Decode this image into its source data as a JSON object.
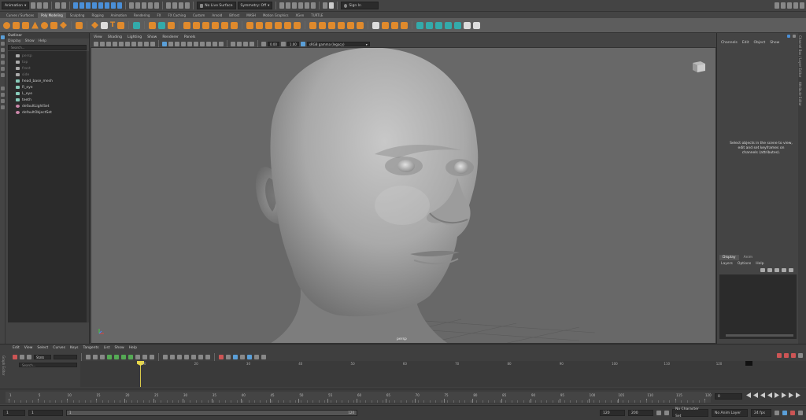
{
  "statusline": {
    "menuset": "Animation",
    "live_surface": "No Live Surface",
    "symmetry": "Symmetry: Off",
    "sign_in": "Sign In"
  },
  "shelf": {
    "tabs": [
      "Curves / Surfaces",
      "Poly Modeling",
      "Sculpting",
      "Rigging",
      "Animation",
      "Rendering",
      "FX",
      "FX Caching",
      "Custom",
      "Arnold",
      "Bifrost",
      "MASH",
      "Motion Graphics",
      "XGen",
      "TURTLE"
    ],
    "active_tab": "Poly Modeling"
  },
  "outliner": {
    "title": "Outliner",
    "menu": [
      "Display",
      "Show",
      "Help"
    ],
    "search_placeholder": "Search...",
    "items": [
      {
        "label": "persp",
        "dim": true,
        "type": "camera"
      },
      {
        "label": "top",
        "dim": true,
        "type": "camera"
      },
      {
        "label": "front",
        "dim": true,
        "type": "camera"
      },
      {
        "label": "side",
        "dim": true,
        "type": "camera"
      },
      {
        "label": "head_base_mesh",
        "dim": false,
        "type": "mesh"
      },
      {
        "label": "R_eye",
        "dim": false,
        "type": "mesh"
      },
      {
        "label": "L_eye",
        "dim": false,
        "type": "mesh"
      },
      {
        "label": "teeth",
        "dim": false,
        "type": "mesh"
      },
      {
        "label": "defaultLightSet",
        "dim": false,
        "type": "set"
      },
      {
        "label": "defaultObjectSet",
        "dim": false,
        "type": "set"
      }
    ]
  },
  "viewport": {
    "menu": [
      "View",
      "Shading",
      "Lighting",
      "Show",
      "Renderer",
      "Panels"
    ],
    "field1": "0.00",
    "field2": "1.00",
    "colorspace": "sRGB gamma (legacy)",
    "camera": "persp"
  },
  "channelbox": {
    "menu": [
      "Channels",
      "Edit",
      "Object",
      "Show"
    ],
    "hint": "Select objects in the scene to view, edit and set keyframes on channels (attributes).",
    "layer_tabs": [
      "Display",
      "Anim"
    ],
    "layer_menu": [
      "Layers",
      "Options",
      "Help"
    ],
    "side_tabs": [
      "Channel Box / Layer Editor",
      "Attribute Editor"
    ]
  },
  "grapheditor": {
    "menu": [
      "Edit",
      "View",
      "Select",
      "Curves",
      "Keys",
      "Tangents",
      "List",
      "Show",
      "Help"
    ],
    "stats_label": "Stats",
    "search_placeholder": "Search...",
    "side_label": "Graph Editor",
    "ruler": [
      "10",
      "20",
      "30",
      "40",
      "50",
      "60",
      "70",
      "80",
      "90",
      "100",
      "110",
      "120"
    ]
  },
  "timeslider": {
    "ticks": [
      "1",
      "5",
      "10",
      "15",
      "20",
      "25",
      "30",
      "35",
      "40",
      "45",
      "50",
      "55",
      "60",
      "65",
      "70",
      "75",
      "80",
      "85",
      "90",
      "95",
      "100",
      "105",
      "110",
      "115",
      "120"
    ],
    "current_frame": "0"
  },
  "range": {
    "start": "1",
    "anim_start": "1",
    "range_start_label": "1",
    "range_end_label": "120",
    "end": "120",
    "anim_end": "200",
    "character_set": "No Character Set",
    "anim_layer": "No Anim Layer",
    "fps": "24 fps"
  }
}
